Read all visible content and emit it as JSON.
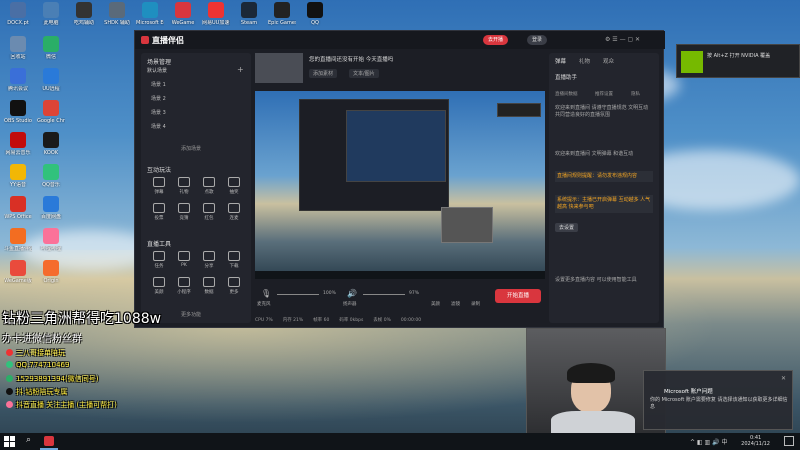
{
  "desktop_icons": [
    {
      "label": "DOCX.pt",
      "color": "#4a6fa5"
    },
    {
      "label": "此电脑",
      "color": "#4a7fb5"
    },
    {
      "label": "吃鸡辅助",
      "color": "#333"
    },
    {
      "label": "SHDK 辅助",
      "color": "#5a6a7a"
    },
    {
      "label": "Microsoft Edge",
      "color": "#1f8fc0"
    },
    {
      "label": "WeGame",
      "color": "#d9363e"
    },
    {
      "label": "网易UU加速器",
      "color": "#e33"
    },
    {
      "label": "Steam",
      "color": "#1b2838"
    },
    {
      "label": "Epic Games",
      "color": "#222"
    },
    {
      "label": "QQ",
      "color": "#111"
    },
    {
      "label": "回收站",
      "color": "#6b8bb0"
    },
    {
      "label": "微信",
      "color": "#2aae67"
    },
    {
      "label": "腾讯会议",
      "color": "#3a6fd8"
    },
    {
      "label": "UU远程",
      "color": "#2a7ad9"
    },
    {
      "label": "OBS Studio",
      "color": "#111"
    },
    {
      "label": "Google Chrome",
      "color": "#dc4437"
    },
    {
      "label": "网易云音乐",
      "color": "#c20c0c"
    },
    {
      "label": "KOOK",
      "color": "#1a1a1a"
    },
    {
      "label": "YY语音",
      "color": "#f2b705"
    },
    {
      "label": "QQ音乐",
      "color": "#31c27c"
    },
    {
      "label": "WPS Office",
      "color": "#d93025"
    },
    {
      "label": "百度网盘",
      "color": "#2a7ad9"
    },
    {
      "label": "斗鱼直播伴侣",
      "color": "#f36d21"
    },
    {
      "label": "哔哩哔哩",
      "color": "#fb7299"
    },
    {
      "label": "WeGame版",
      "color": "#e94b3c"
    },
    {
      "label": "Origin",
      "color": "#f56c2d"
    },
    {
      "label": "Battle.net",
      "color": "#148eff"
    }
  ],
  "app": {
    "brand": "直播伴侣",
    "top_buttons": [
      "去开播",
      "登录"
    ],
    "left": {
      "scene_header": "场景管理",
      "scene_tab": "默认场景",
      "scenes": [
        "场景 1",
        "场景 2",
        "场景 3",
        "场景 4"
      ],
      "add_scene": "添加场景",
      "tools_header": "互动玩法",
      "tools": [
        "弹幕",
        "礼物",
        "点歌",
        "抽奖",
        "投票",
        "竞猜",
        "红包",
        "连麦"
      ],
      "extra_header": "直播工具",
      "extra_tools": [
        "任务",
        "PK",
        "分享",
        "下载",
        "美颜",
        "小程序",
        "数据",
        "更多"
      ],
      "more": "更多功能"
    },
    "preview_header": "您的直播间还没有开始 今天直播吗",
    "preview_sub": [
      "添加素材",
      "文本/图片"
    ],
    "right": {
      "tabs": [
        "弹幕",
        "礼物",
        "观众"
      ],
      "title": "直播助手",
      "links": [
        "直播间数据",
        "推荐设置",
        "隐私"
      ],
      "intro": "欢迎来到直播间 请遵守直播规范 文明互动 共同营造良好的直播氛围",
      "msg1": "欢迎来到直播间 文明弹幕 和谐互动",
      "highlight1": "直播间规则提醒：请勿发布违规内容",
      "highlight2": "系统提示：主播已开启弹幕 互动越多 人气越高 快来参与吧",
      "button": "去设置",
      "footer": "设置更多直播内容 可以使用智能工具"
    },
    "bottom": {
      "mic_label": "麦克风",
      "mic_vol": "100%",
      "speaker_label": "扬声器",
      "speaker_vol": "97%",
      "icons": [
        "美颜",
        "滤镜",
        "录制"
      ],
      "start_button": "开始直播"
    },
    "status": [
      "CPU 7%",
      "内存 21%",
      "帧率 60",
      "码率 0kbps",
      "丢帧 0%",
      "00:00:00"
    ]
  },
  "overlay": {
    "big": "钻粉三角洲帮得吃1088w",
    "mid": "办卡进微信粉丝群",
    "lines": [
      {
        "text": "三八哥接单陪玩",
        "color": "#e33"
      },
      {
        "text": "QQ:774710469",
        "color": "#31c27c"
      },
      {
        "text": "15293891394(微信同号)",
        "color": "#2aae67"
      },
      {
        "text": "抖:钻粉陪玩专属",
        "color": "#111"
      },
      {
        "text": "抖音直播  关注主播 (主播可帮打)",
        "color": "#fb7299"
      }
    ]
  },
  "nvidia": {
    "title": "按 Alt+Z 打开 NVIDIA 覆盖"
  },
  "toast": {
    "title": "Microsoft 账户问题",
    "body": "你的 Microsoft 账户需要修复 请选择该通知以获取更多详细信息"
  },
  "taskbar": {
    "time": "0:41",
    "date": "2024/11/12"
  }
}
